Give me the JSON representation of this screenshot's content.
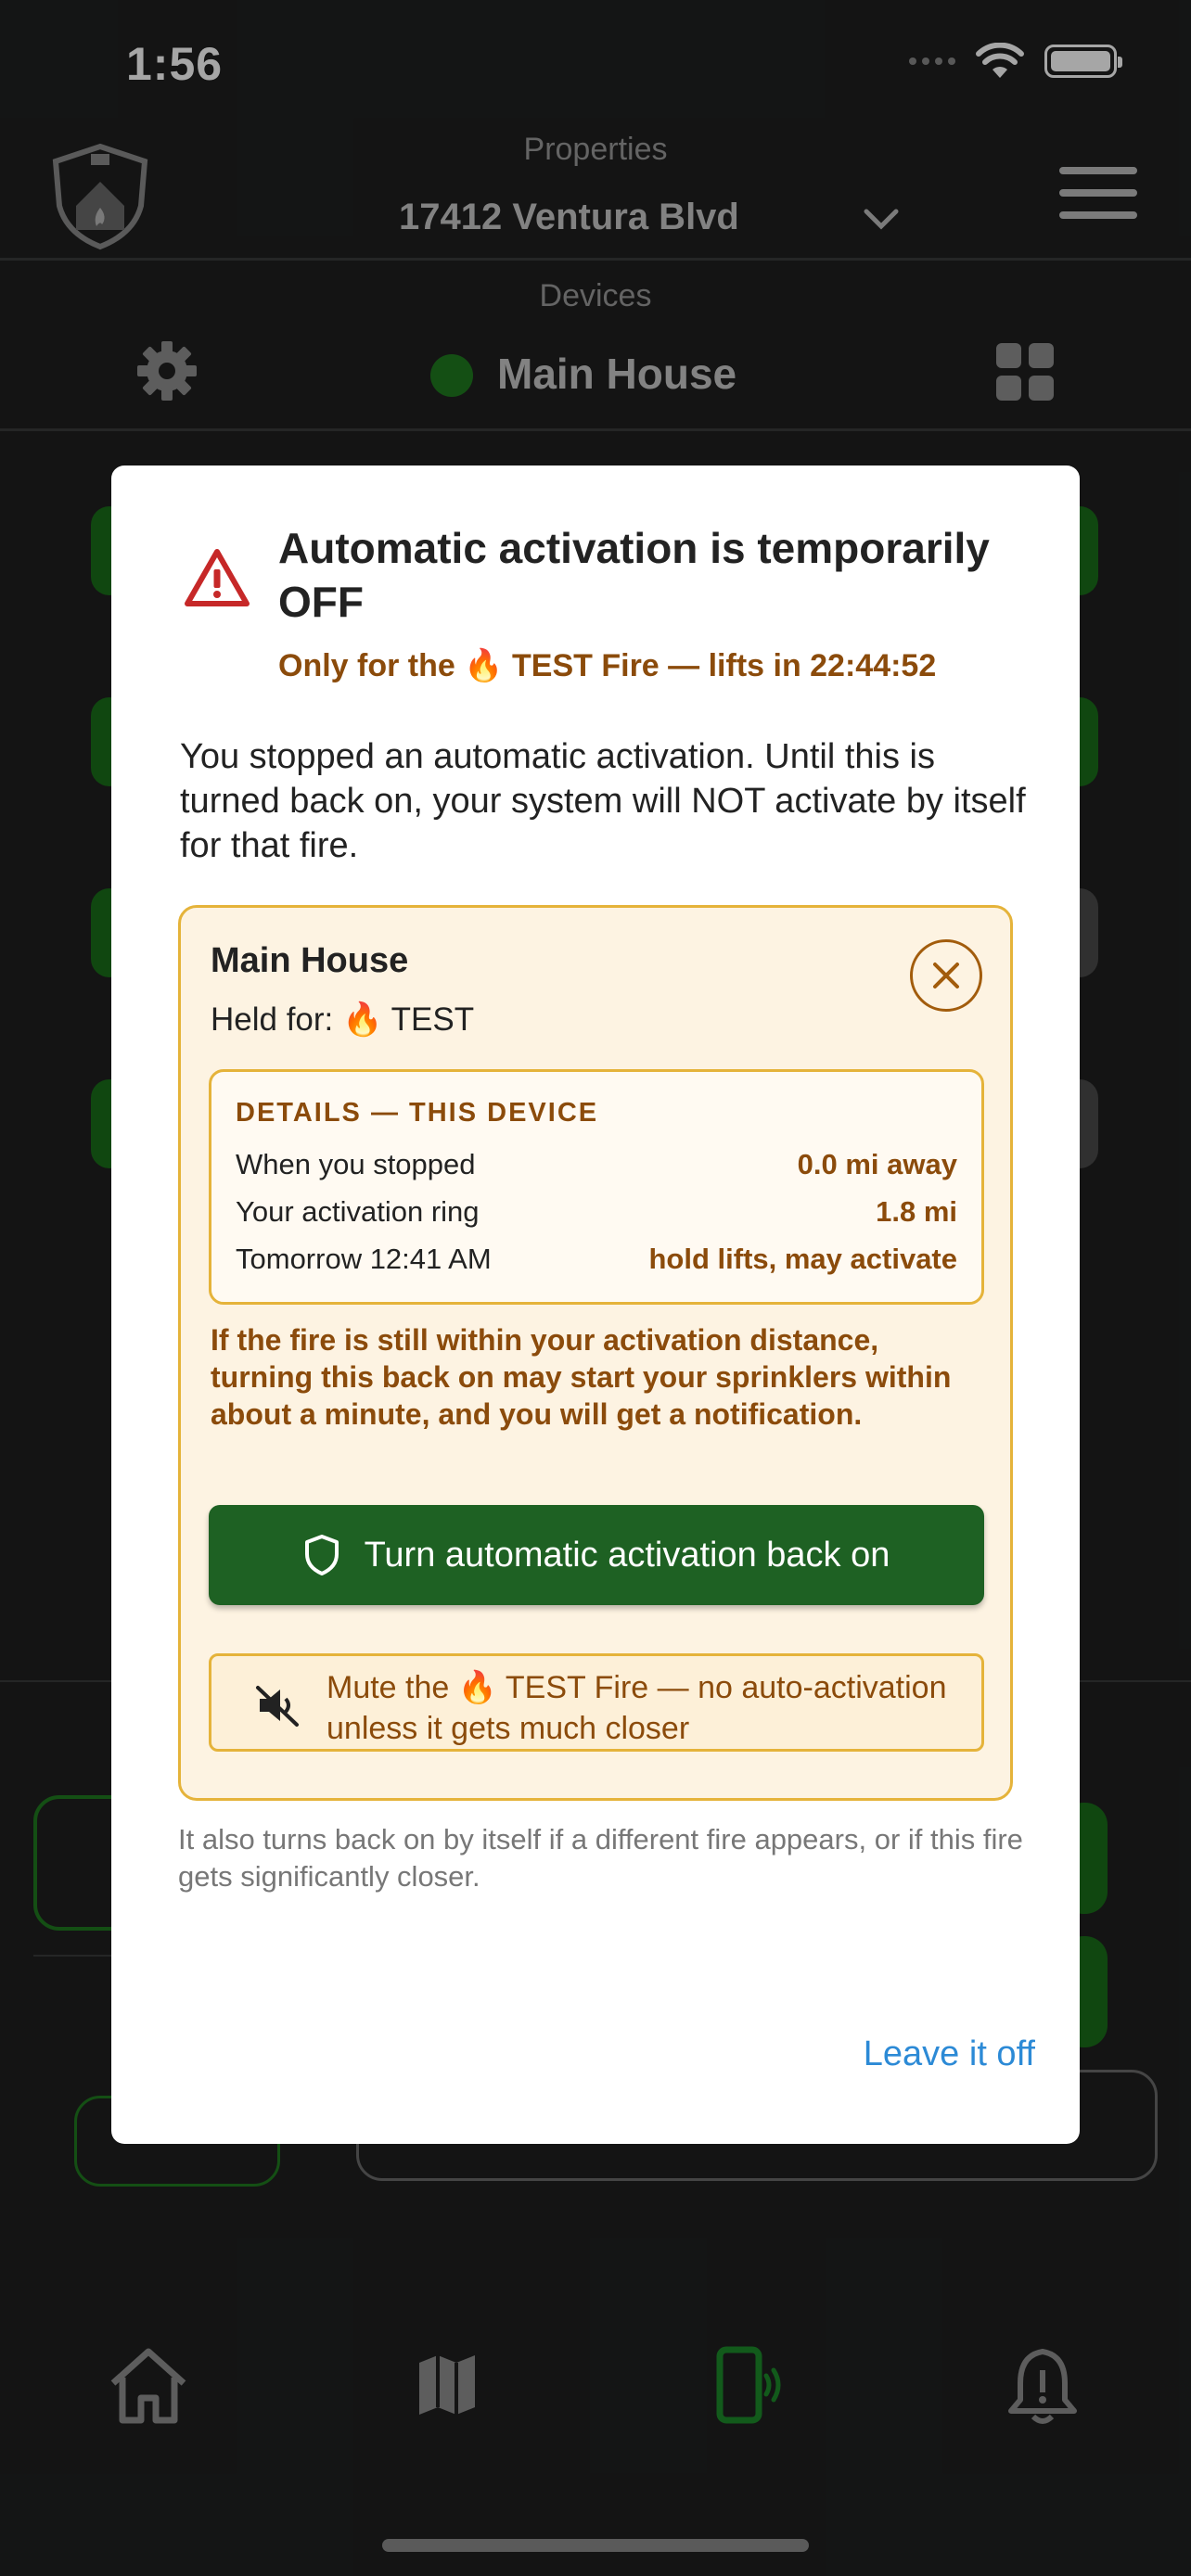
{
  "status_bar": {
    "time": "1:56"
  },
  "header": {
    "properties_label": "Properties",
    "property_name": "17412 Ventura Blvd",
    "devices_label": "Devices",
    "device_name": "Main House"
  },
  "modal": {
    "title": "Automatic activation is temporarily OFF",
    "subtitle": "Only for the 🔥 TEST Fire — lifts in 22:44:52",
    "description": "You stopped an automatic activation. Until this is turned back on, your system will NOT activate by itself for that fire.",
    "card": {
      "device_name": "Main House",
      "held_for": "Held for: 🔥 TEST",
      "details_heading": "DETAILS — THIS DEVICE",
      "details": [
        {
          "key": "When you stopped",
          "value": "0.0 mi away"
        },
        {
          "key": "Your activation ring",
          "value": "1.8 mi"
        },
        {
          "key": "Tomorrow 12:41 AM",
          "value": "hold lifts, may activate"
        }
      ],
      "warning": "If the fire is still within your activation distance, turning this back on may start your sprinklers within about a minute, and you will get a notification.",
      "turn_on_label": "Turn automatic activation back on",
      "mute_label": "Mute the 🔥 TEST Fire — no auto-activation unless it gets much closer"
    },
    "footnote": "It also turns back on by itself if a different fire appears, or if this fire gets significantly closer.",
    "leave_label": "Leave it off"
  },
  "colors": {
    "brand_green": "#1e6123",
    "warning_red": "#c62828",
    "amber_text": "#8b4b0b",
    "amber_border": "#e5b33a",
    "card_bg": "#fdf3e2",
    "link_blue": "#2c8ad6"
  }
}
